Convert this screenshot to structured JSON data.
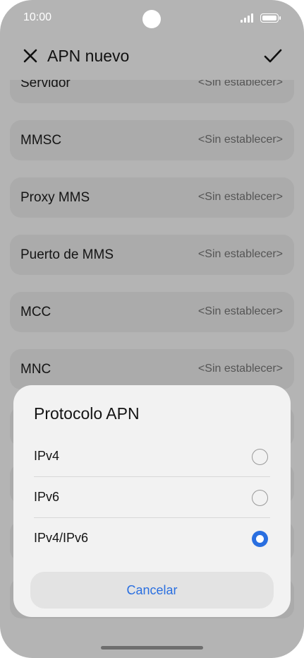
{
  "status_bar": {
    "time": "10:00"
  },
  "header": {
    "title": "APN nuevo",
    "close_icon": "close-icon",
    "confirm_icon": "check-icon"
  },
  "settings_rows": [
    {
      "label": "Servidor",
      "value": "<Sin establecer>"
    },
    {
      "label": "MMSC",
      "value": "<Sin establecer>"
    },
    {
      "label": "Proxy MMS",
      "value": "<Sin establecer>"
    },
    {
      "label": "Puerto de MMS",
      "value": "<Sin establecer>"
    },
    {
      "label": "MCC",
      "value": "<Sin establecer>"
    },
    {
      "label": "MNC",
      "value": "<Sin establecer>"
    }
  ],
  "dialog": {
    "title": "Protocolo APN",
    "options": [
      {
        "label": "IPv4",
        "selected": false
      },
      {
        "label": "IPv6",
        "selected": false
      },
      {
        "label": "IPv4/IPv6",
        "selected": true
      }
    ],
    "cancel_label": "Cancelar"
  },
  "colors": {
    "accent": "#2a6fe0",
    "scrim_background": "#b4b4b4",
    "sheet_background": "#f2f2f2"
  }
}
